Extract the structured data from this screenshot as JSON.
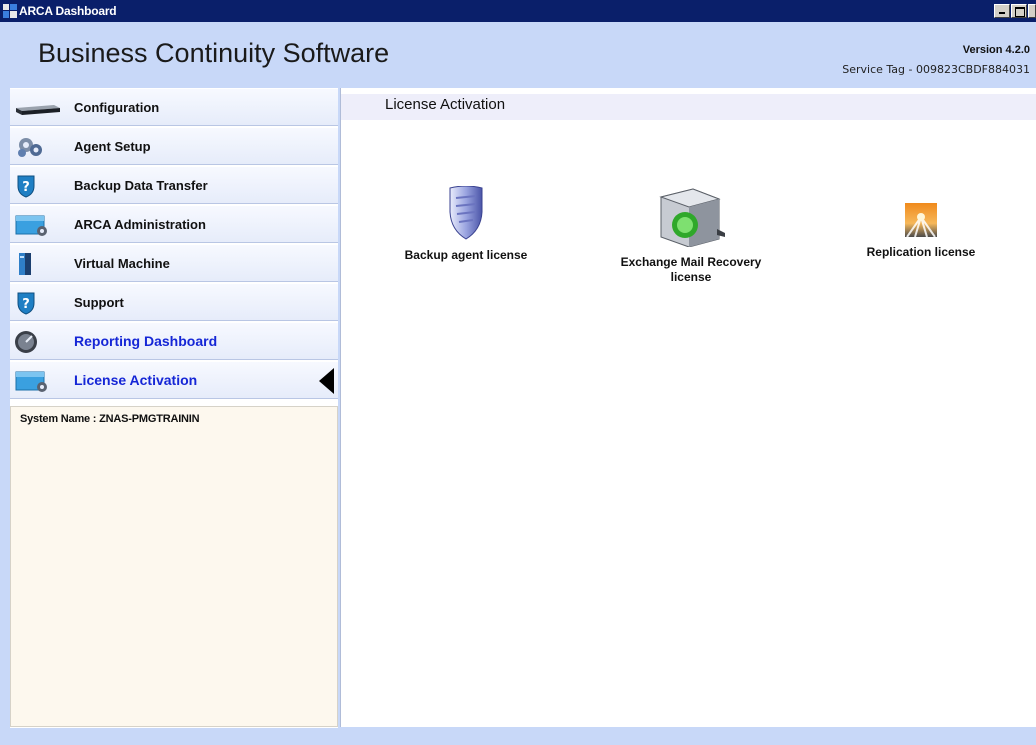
{
  "window": {
    "title": "ARCA Dashboard"
  },
  "header": {
    "brand": "Business Continuity Software",
    "version": "Version 4.2.0",
    "service_tag": "Service Tag - 009823CBDF884031"
  },
  "sidebar": {
    "items": [
      {
        "label": "Configuration",
        "icon": "server-icon"
      },
      {
        "label": "Agent Setup",
        "icon": "gear-cluster-icon"
      },
      {
        "label": "Backup Data Transfer",
        "icon": "shield-question-icon"
      },
      {
        "label": "ARCA Administration",
        "icon": "admin-folder-icon"
      },
      {
        "label": "Virtual Machine",
        "icon": "tower-icon"
      },
      {
        "label": "Support",
        "icon": "shield-question-icon"
      },
      {
        "label": "Reporting Dashboard",
        "icon": "gauge-icon"
      },
      {
        "label": "License Activation",
        "icon": "admin-folder-icon",
        "active": true
      }
    ],
    "system_name": "System Name : ZNAS-PMGTRAININ"
  },
  "main": {
    "heading": "License Activation",
    "licenses": [
      {
        "label": "Backup agent license",
        "icon": "shield-icon"
      },
      {
        "label": "Exchange Mail Recovery license",
        "icon": "mail-server-icon"
      },
      {
        "label": "Replication license",
        "icon": "replication-icon"
      }
    ]
  },
  "colors": {
    "titlebar": "#0a1f6a",
    "frame": "#c8d8f8",
    "active_link": "#1526d6",
    "sysinfo_bg": "#fdf8ee"
  }
}
